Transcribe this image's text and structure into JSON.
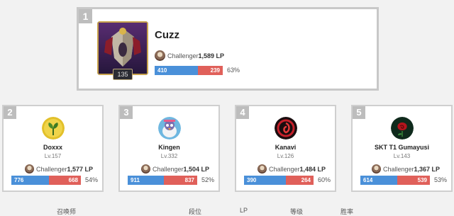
{
  "top": {
    "rank": "1",
    "name": "Cuzz",
    "level": "135",
    "tier": "Challenger",
    "lp": "1,589 LP",
    "wins": "410",
    "losses": "239",
    "winrate": "63%"
  },
  "players": [
    {
      "rank": "2",
      "name": "Doxxx",
      "level": "Lv.157",
      "tier": "Challenger",
      "lp": "1,577 LP",
      "wins": "776",
      "losses": "668",
      "winrate": "54%"
    },
    {
      "rank": "3",
      "name": "Kingen",
      "level": "Lv.332",
      "tier": "Challenger",
      "lp": "1,504 LP",
      "wins": "911",
      "losses": "837",
      "winrate": "52%"
    },
    {
      "rank": "4",
      "name": "Kanavi",
      "level": "Lv.126",
      "tier": "Challenger",
      "lp": "1,484 LP",
      "wins": "390",
      "losses": "264",
      "winrate": "60%"
    },
    {
      "rank": "5",
      "name": "SKT T1 Gumayusi",
      "level": "Lv.143",
      "tier": "Challenger",
      "lp": "1,367 LP",
      "wins": "614",
      "losses": "539",
      "winrate": "53%"
    }
  ],
  "table_header": {
    "summoner": "召唤师",
    "tier": "段位",
    "lp": "LP",
    "level": "等级",
    "winrate": "胜率"
  },
  "colors": {
    "win": "#4a90d9",
    "loss": "#e0605a"
  }
}
